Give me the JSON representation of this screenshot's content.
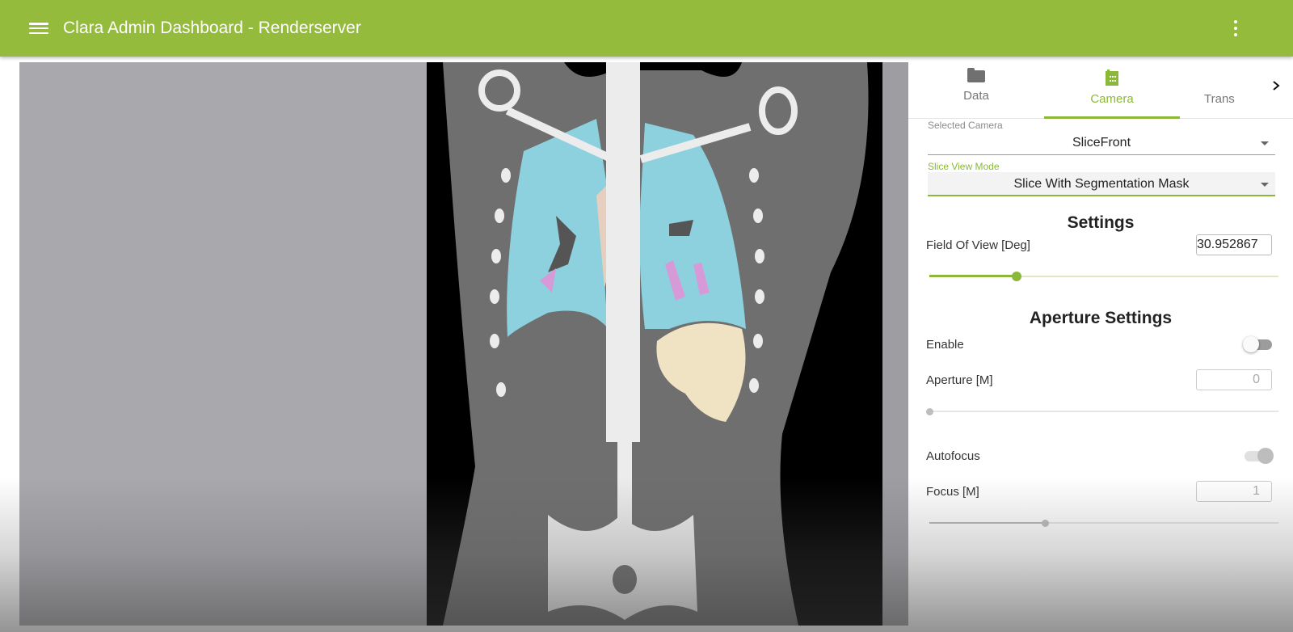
{
  "appbar": {
    "title": "Clara Admin Dashboard - Renderserver",
    "menu_icon": "hamburger-menu-icon",
    "more_icon": "more-vertical-icon",
    "color": "#94bb3b"
  },
  "viewport": {
    "description": "Coronal CT slice with segmentation mask (lungs in cyan, vessels in pink, liver/spleen region in beige)",
    "segment_colors": {
      "lungs": "#8dd0de",
      "vessels": "#d69ad8",
      "organ": "#efe3c4",
      "trachea": "#e7cfc0"
    }
  },
  "panel": {
    "tabs": [
      {
        "label": "Data",
        "icon": "folder-icon",
        "active": false
      },
      {
        "label": "Camera",
        "icon": "camera-icon",
        "active": true
      },
      {
        "label": "Trans",
        "icon": "",
        "active": false
      }
    ],
    "tab_next_icon": "chevron-right-icon",
    "selected_camera": {
      "label": "Selected Camera",
      "value": "SliceFront"
    },
    "slice_view_mode": {
      "label": "Slice View Mode",
      "value": "Slice With Segmentation Mask"
    },
    "settings": {
      "title": "Settings",
      "fov": {
        "label": "Field Of View [Deg]",
        "value": "30.952867",
        "slider_fraction": 0.25
      }
    },
    "aperture_settings": {
      "title": "Aperture Settings",
      "enable": {
        "label": "Enable",
        "on": false
      },
      "aperture": {
        "label": "Aperture [M]",
        "value": "0",
        "slider_fraction": 0.0
      },
      "autofocus": {
        "label": "Autofocus",
        "on": true
      },
      "focus": {
        "label": "Focus [M]",
        "value": "1",
        "slider_fraction": 0.33
      }
    }
  }
}
